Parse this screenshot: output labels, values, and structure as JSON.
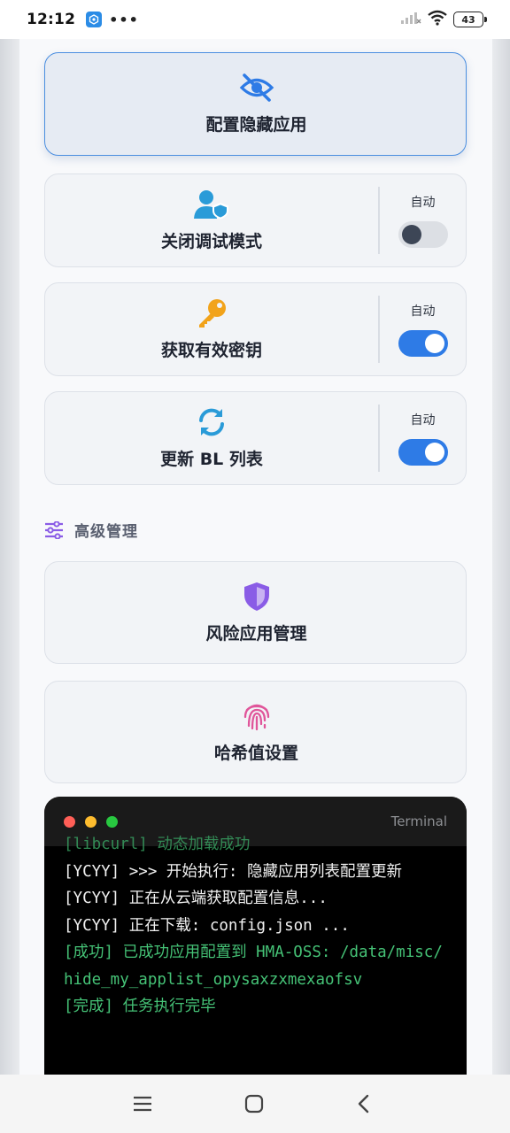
{
  "status_bar": {
    "time": "12:12",
    "dots": "•••",
    "battery": "43"
  },
  "cards": [
    {
      "title": "配置隐藏应用",
      "icon": "eye-off-icon"
    },
    {
      "title": "关闭调试模式",
      "icon": "user-shield-icon",
      "auto_label": "自动",
      "toggle_on": false
    },
    {
      "title": "获取有效密钥",
      "icon": "key-icon",
      "auto_label": "自动",
      "toggle_on": true
    },
    {
      "title": "更新 BL 列表",
      "icon": "refresh-icon",
      "auto_label": "自动",
      "toggle_on": true
    }
  ],
  "section": {
    "title": "高级管理",
    "icon": "sliders-icon"
  },
  "advanced_cards": [
    {
      "title": "风险应用管理",
      "icon": "shield-icon"
    },
    {
      "title": "哈希值设置",
      "icon": "fingerprint-icon"
    }
  ],
  "terminal": {
    "title": "Terminal",
    "lines": [
      {
        "text": "[libcurl] 动态加载成功",
        "color": "green"
      },
      {
        "text": "[YCYY] >>> 开始执行: 隐藏应用列表配置更新",
        "color": "white"
      },
      {
        "text": "[YCYY] 正在从云端获取配置信息...",
        "color": "white"
      },
      {
        "text": "[YCYY] 正在下载: config.json ...",
        "color": "white"
      },
      {
        "text": "[成功] 已成功应用配置到 HMA-OSS: /data/misc/hide_my_applist_opysaxzxmexaofsv",
        "color": "green"
      },
      {
        "text": "[完成] 任务执行完毕",
        "color": "green"
      }
    ]
  },
  "colors": {
    "accent": "#2e7be6",
    "terminal_green": "#45c276",
    "key": "#f2a31b",
    "shield": "#8a5ce6",
    "fingerprint": "#e0559a"
  }
}
